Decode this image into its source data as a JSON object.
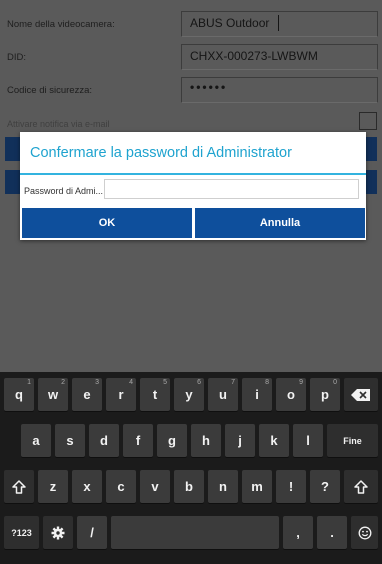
{
  "form": {
    "camera_name_label": "Nome della videocamera:",
    "camera_name_value": "ABUS Outdoor",
    "did_label": "DID:",
    "did_value": "CHXX-000273-LWBWM",
    "security_code_label": "Codice di sicurezza:",
    "security_code_value": "••••••",
    "notify_label": "Attivare notifica via e-mail"
  },
  "dialog": {
    "title": "Confermare la password di Administrator",
    "field_label": "Password di Admi...",
    "field_value": "",
    "ok_label": "OK",
    "cancel_label": "Annulla"
  },
  "keyboard": {
    "row1": [
      {
        "k": "q",
        "h": "1"
      },
      {
        "k": "w",
        "h": "2"
      },
      {
        "k": "e",
        "h": "3"
      },
      {
        "k": "r",
        "h": "4"
      },
      {
        "k": "t",
        "h": "5"
      },
      {
        "k": "y",
        "h": "6"
      },
      {
        "k": "u",
        "h": "7"
      },
      {
        "k": "i",
        "h": "8"
      },
      {
        "k": "o",
        "h": "9"
      },
      {
        "k": "p",
        "h": "0"
      }
    ],
    "row2": [
      "a",
      "s",
      "d",
      "f",
      "g",
      "h",
      "j",
      "k",
      "l"
    ],
    "enter_label": "Fine",
    "row3": [
      "z",
      "x",
      "c",
      "v",
      "b",
      "n",
      "m",
      "!",
      "?"
    ],
    "symbols_label": "?123",
    "slash_label": "/",
    "comma_label": ",",
    "period_label": ".",
    "icons": [
      "backspace-icon",
      "shift-icon",
      "settings-icon",
      "emoji-icon"
    ]
  }
}
